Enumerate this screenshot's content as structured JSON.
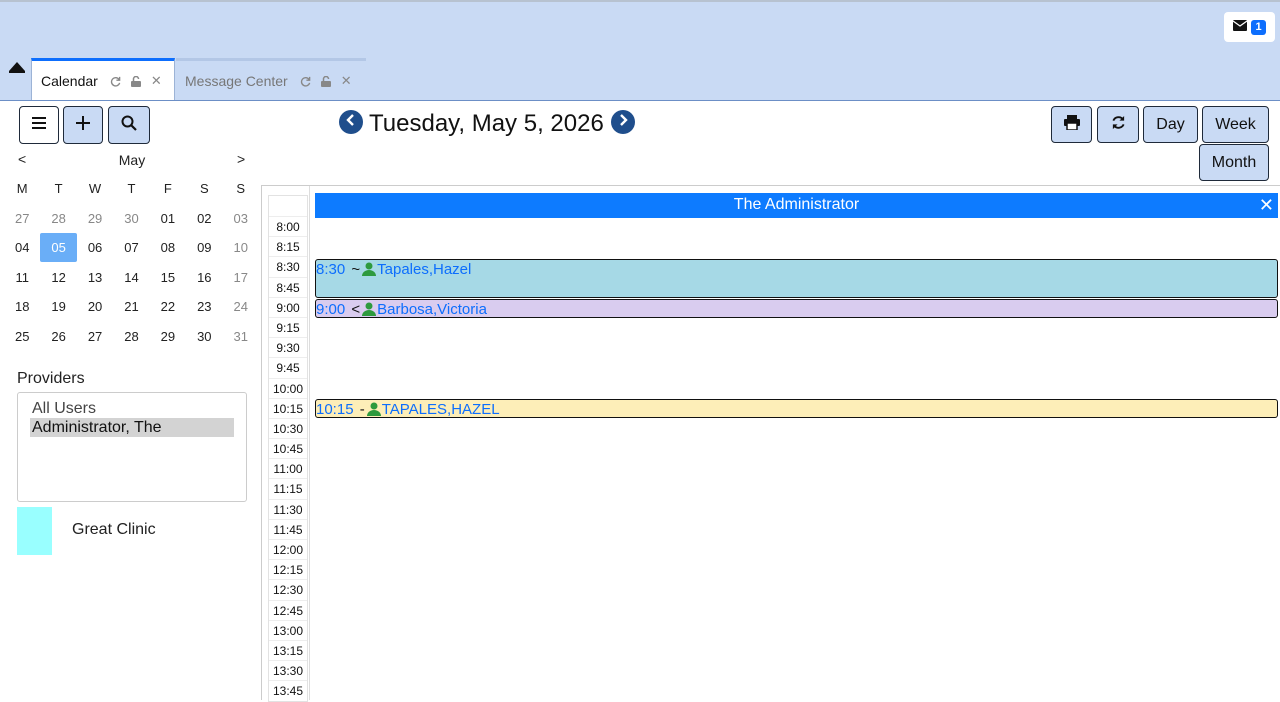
{
  "messages": {
    "badge_count": "1",
    "icon": "envelope-icon"
  },
  "tabs": [
    {
      "label": "Calendar",
      "active": true
    },
    {
      "label": "Message Center",
      "active": false
    }
  ],
  "toolbar": {
    "menu_icon": "menu-icon",
    "add_icon": "plus-icon",
    "search_icon": "search-icon"
  },
  "mini_calendar": {
    "prev": "<",
    "next": ">",
    "month": "May",
    "weekdays": [
      "M",
      "T",
      "W",
      "T",
      "F",
      "S",
      "S"
    ],
    "weeks": [
      [
        "27",
        "28",
        "29",
        "30",
        "01",
        "02",
        "03"
      ],
      [
        "04",
        "05",
        "06",
        "07",
        "08",
        "09",
        "10"
      ],
      [
        "11",
        "12",
        "13",
        "14",
        "15",
        "16",
        "17"
      ],
      [
        "18",
        "19",
        "20",
        "21",
        "22",
        "23",
        "24"
      ],
      [
        "25",
        "26",
        "27",
        "28",
        "29",
        "30",
        "31"
      ]
    ],
    "selected": "05"
  },
  "providers": {
    "label": "Providers",
    "options": [
      "All Users",
      "Administrator, The"
    ],
    "selected": "Administrator, The"
  },
  "facility": {
    "name": "Great Clinic",
    "color": "#99ffff"
  },
  "header": {
    "date": "Tuesday, May 5, 2026"
  },
  "view_buttons": {
    "print_icon": "print-icon",
    "refresh_icon": "refresh-icon",
    "day": "Day",
    "week": "Week",
    "month": "Month"
  },
  "schedule": {
    "provider_name": "The Administrator",
    "close": "✕",
    "times": [
      "8:00",
      "8:15",
      "8:30",
      "8:45",
      "9:00",
      "9:15",
      "9:30",
      "9:45",
      "10:00",
      "10:15",
      "10:30",
      "10:45",
      "11:00",
      "11:15",
      "11:30",
      "11:45",
      "12:00",
      "12:15",
      "12:30",
      "12:45",
      "13:00",
      "13:15",
      "13:30",
      "13:45"
    ],
    "appointments": [
      {
        "time": "8:30",
        "symbol": "~",
        "patient": "Tapales,Hazel",
        "color": "#a6d9e6"
      },
      {
        "time": "9:00",
        "symbol": "<",
        "patient": "Barbosa,Victoria",
        "color": "#d9ccef"
      },
      {
        "time": "10:15",
        "symbol": "-",
        "patient": "TAPALES,HAZEL",
        "color": "#fdeeb8"
      }
    ]
  }
}
